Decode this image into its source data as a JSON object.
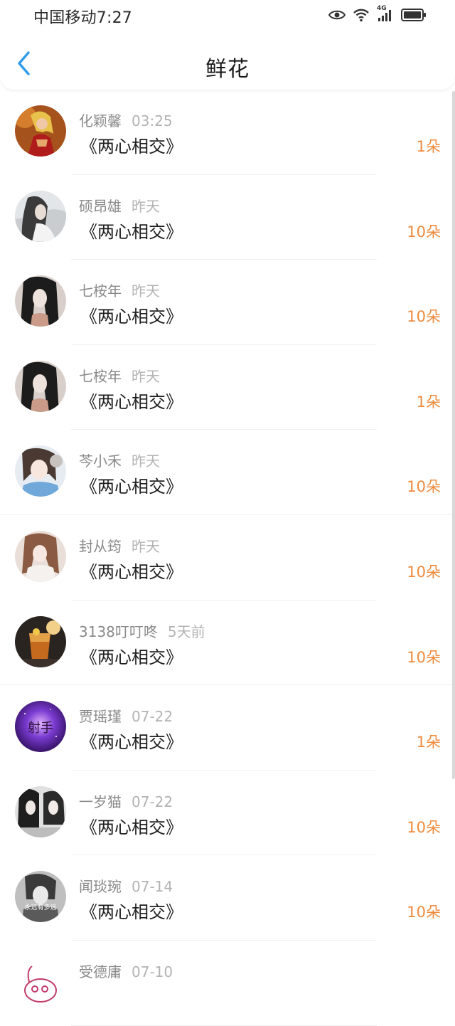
{
  "status_bar": {
    "carrier_time": "中国移动7:27",
    "network": "4G",
    "icons": [
      "eye-icon",
      "wifi-icon",
      "signal-icon",
      "battery-icon"
    ]
  },
  "header": {
    "title": "鲜花",
    "back_icon": "chevron-left-icon"
  },
  "colors": {
    "accent_blue": "#2f9bea",
    "count_orange": "#ee8a3c"
  },
  "items": [
    {
      "name": "化颖馨",
      "time": "03:25",
      "title": "《两心相交》",
      "count": "1朵"
    },
    {
      "name": "硕昂雄",
      "time": "昨天",
      "title": "《两心相交》",
      "count": "10朵"
    },
    {
      "name": "七桉年",
      "time": "昨天",
      "title": "《两心相交》",
      "count": "10朵"
    },
    {
      "name": "七桉年",
      "time": "昨天",
      "title": "《两心相交》",
      "count": "1朵"
    },
    {
      "name": "芩小禾",
      "time": "昨天",
      "title": "《两心相交》",
      "count": "10朵"
    },
    {
      "name": "封从筠",
      "time": "昨天",
      "title": "《两心相交》",
      "count": "10朵"
    },
    {
      "name": "3138叮叮咚",
      "time": "5天前",
      "title": "《两心相交》",
      "count": "10朵"
    },
    {
      "name": "贾瑶瑾",
      "time": "07-22",
      "title": "《两心相交》",
      "count": "1朵"
    },
    {
      "name": "一岁猫",
      "time": "07-22",
      "title": "《两心相交》",
      "count": "10朵"
    },
    {
      "name": "闻琰琬",
      "time": "07-14",
      "title": "《两心相交》",
      "count": "10朵"
    },
    {
      "name": "受德庸",
      "time": "07-10",
      "title": "",
      "count": ""
    }
  ],
  "avatar_texts": {
    "item_7": "射手",
    "item_9": "永远有多远"
  }
}
